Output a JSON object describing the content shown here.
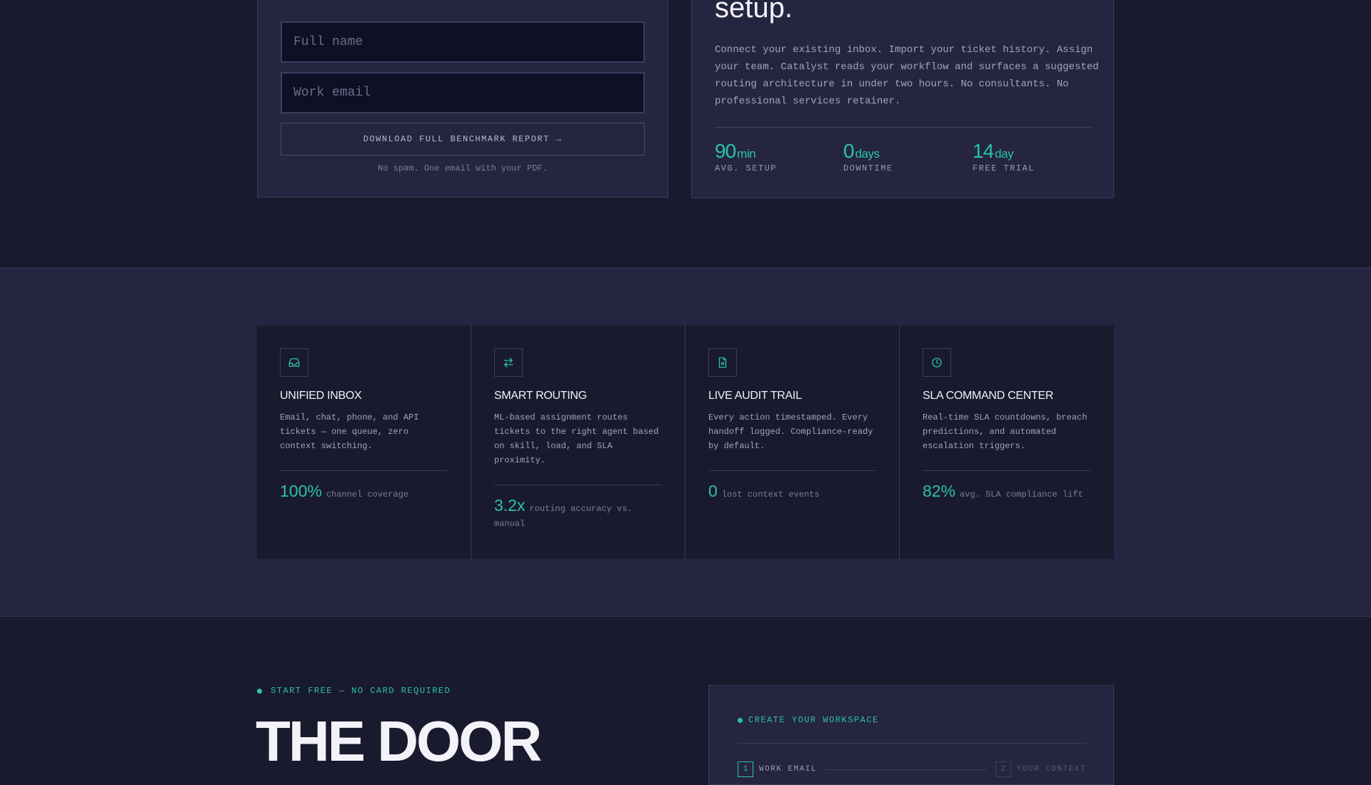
{
  "benchmark_form": {
    "name_placeholder": "Full name",
    "email_placeholder": "Work email",
    "download_label": "DOWNLOAD FULL BENCHMARK REPORT →",
    "note": "No spam. One email with your PDF."
  },
  "setup": {
    "title": "setup.",
    "body": "Connect your existing inbox. Import your ticket history. Assign your team. Catalyst reads your workflow and surfaces a suggested routing architecture in under two hours. No consultants. No professional services retainer.",
    "stats": [
      {
        "value": "90",
        "unit": "min",
        "label": "AVG. SETUP"
      },
      {
        "value": "0",
        "unit": "days",
        "label": "DOWNTIME"
      },
      {
        "value": "14",
        "unit": "day",
        "label": "FREE TRIAL"
      }
    ]
  },
  "features": [
    {
      "icon": "inbox-icon",
      "title": "UNIFIED INBOX",
      "desc": "Email, chat, phone, and API tickets — one queue, zero context switching.",
      "metric_value": "100%",
      "metric_label": "channel coverage"
    },
    {
      "icon": "arrows-swap-icon",
      "title": "SMART ROUTING",
      "desc": "ML-based assignment routes tickets to the right agent based on skill, load, and SLA proximity.",
      "metric_value": "3.2x",
      "metric_label": "routing accuracy vs. manual"
    },
    {
      "icon": "document-icon",
      "title": "LIVE AUDIT TRAIL",
      "desc": "Every action timestamped. Every handoff logged. Compliance-ready by default.",
      "metric_value": "0",
      "metric_label": "lost context events"
    },
    {
      "icon": "clock-icon",
      "title": "SLA COMMAND CENTER",
      "desc": "Real-time SLA countdowns, breach predictions, and automated escalation triggers.",
      "metric_value": "82%",
      "metric_label": "avg. SLA compliance lift"
    }
  ],
  "cta": {
    "eyebrow": "START FREE — NO CARD REQUIRED",
    "headline": "THE DOOR"
  },
  "workspace": {
    "eyebrow": "CREATE YOUR WORKSPACE",
    "steps": [
      {
        "num": "1",
        "label": "WORK EMAIL"
      },
      {
        "num": "2",
        "label": "YOUR CONTEXT"
      }
    ]
  },
  "colors": {
    "background": "#1a1a2e",
    "panel": "#252541",
    "accent": "#2bc4a4"
  }
}
